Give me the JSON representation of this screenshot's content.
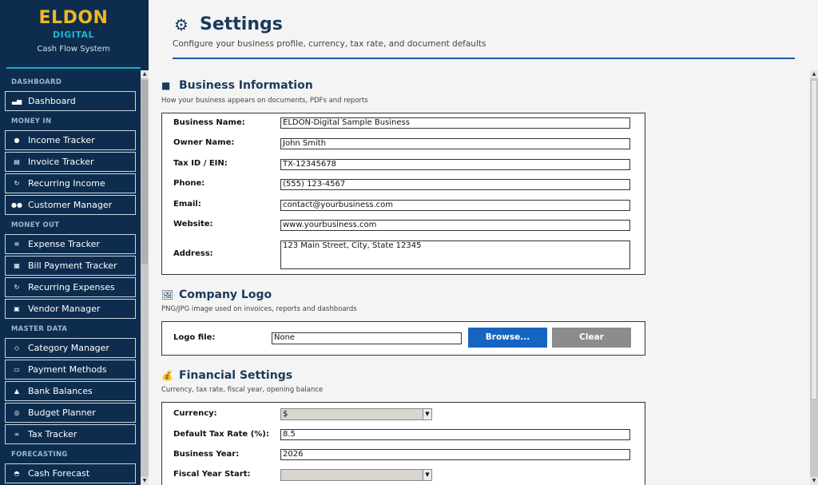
{
  "brand": {
    "name": "ELDON",
    "sub": "DIGITAL",
    "tagline": "Cash Flow System"
  },
  "sidebar": {
    "sections": [
      {
        "label": "DASHBOARD",
        "items": [
          {
            "label": "Dashboard",
            "icon": "bar-chart-icon"
          }
        ]
      },
      {
        "label": "MONEY IN",
        "items": [
          {
            "label": "Income Tracker",
            "icon": "money-bag-icon"
          },
          {
            "label": "Invoice Tracker",
            "icon": "document-icon"
          },
          {
            "label": "Recurring Income",
            "icon": "repeat-icon"
          },
          {
            "label": "Customer Manager",
            "icon": "people-icon"
          }
        ]
      },
      {
        "label": "MONEY OUT",
        "items": [
          {
            "label": "Expense Tracker",
            "icon": "money-wings-icon"
          },
          {
            "label": "Bill Payment Tracker",
            "icon": "receipt-icon"
          },
          {
            "label": "Recurring Expenses",
            "icon": "repeat-icon"
          },
          {
            "label": "Vendor Manager",
            "icon": "store-icon"
          }
        ]
      },
      {
        "label": "MASTER DATA",
        "items": [
          {
            "label": "Category Manager",
            "icon": "tag-icon"
          },
          {
            "label": "Payment Methods",
            "icon": "credit-card-icon"
          },
          {
            "label": "Bank Balances",
            "icon": "bank-icon"
          },
          {
            "label": "Budget Planner",
            "icon": "target-icon"
          },
          {
            "label": "Tax Tracker",
            "icon": "link-icon"
          }
        ]
      },
      {
        "label": "FORECASTING",
        "items": [
          {
            "label": "Cash Forecast",
            "icon": "crystal-ball-icon"
          }
        ]
      }
    ]
  },
  "header": {
    "title": "Settings",
    "subtitle": "Configure your business profile, currency, tax rate, and document defaults"
  },
  "business": {
    "title": "Business Information",
    "subtitle": "How your business appears on documents, PDFs and reports",
    "fields": [
      {
        "label": "Business Name:",
        "value": "ELDON-Digital Sample Business"
      },
      {
        "label": "Owner Name:",
        "value": "John Smith"
      },
      {
        "label": "Tax ID / EIN:",
        "value": "TX-12345678"
      },
      {
        "label": "Phone:",
        "value": "(555) 123-4567"
      },
      {
        "label": "Email:",
        "value": "contact@yourbusiness.com"
      },
      {
        "label": "Website:",
        "value": "www.yourbusiness.com"
      },
      {
        "label": "Address:",
        "value": "123 Main Street, City, State 12345"
      }
    ]
  },
  "logo": {
    "title": "Company Logo",
    "subtitle": "PNG/JPG image used on invoices, reports and dashboards",
    "label": "Logo file:",
    "value": "None",
    "browse": "Browse...",
    "clear": "Clear",
    "browse_color": "#1565c0",
    "clear_color": "#8c8c8c"
  },
  "financial": {
    "title": "Financial Settings",
    "subtitle": "Currency, tax rate, fiscal year, opening balance",
    "currency_label": "Currency:",
    "currency_value": "$",
    "tax_label": "Default Tax Rate (%):",
    "tax_value": "8.5",
    "year_label": "Business Year:",
    "year_value": "2026",
    "fiscal_label": "Fiscal Year Start:"
  },
  "colors": {
    "sidebar_bg": "#0e2d4e",
    "brand_gold": "#f2b720",
    "brand_cyan": "#22b6d4",
    "heading": "#1a3a5c",
    "accent_blue": "#1c5aa6"
  }
}
